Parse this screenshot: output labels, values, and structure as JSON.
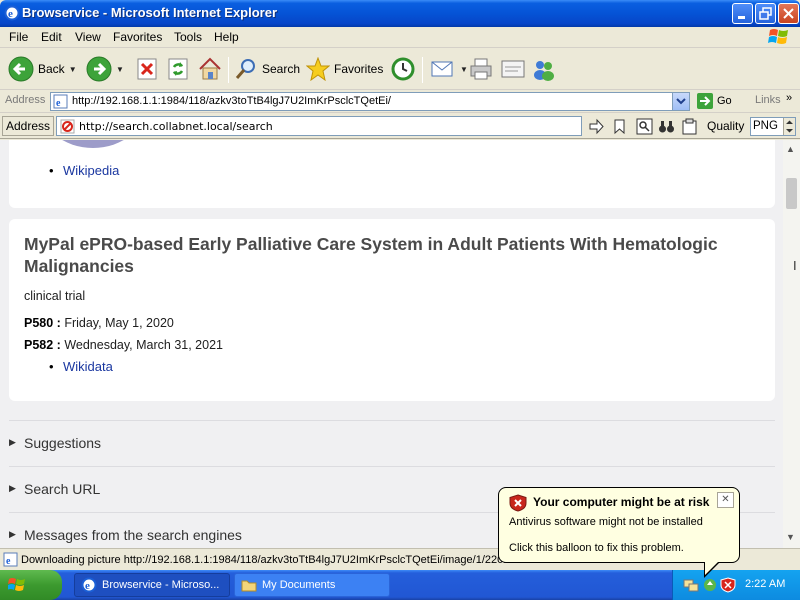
{
  "window": {
    "title": "Browservice - Microsoft Internet Explorer"
  },
  "menu": [
    "File",
    "Edit",
    "View",
    "Favorites",
    "Tools",
    "Help"
  ],
  "toolbar": {
    "back_label": "Back",
    "search_label": "Search",
    "favorites_label": "Favorites"
  },
  "address": {
    "label": "Address",
    "url": "http://192.168.1.1:1984/118/azkv3toTtB4lgJ7U2ImKrPsclcTQetEi/",
    "go_label": "Go",
    "links_label": "Links"
  },
  "inner_address": {
    "label": "Address",
    "url": "http://search.collabnet.local/search",
    "quality_label": "Quality",
    "quality_value": "PNG"
  },
  "content": {
    "card1_link": "Wikipedia",
    "result": {
      "title": "MyPal ePRO-based Early Palliative Care System in Adult Patients With Hematologic Malignancies",
      "type": "clinical trial",
      "props": [
        {
          "key": "P580 :",
          "value": " Friday, May 1, 2020"
        },
        {
          "key": "P582 :",
          "value": " Wednesday, March 31, 2021"
        }
      ],
      "link": "Wikidata"
    },
    "sections": [
      "Suggestions",
      "Search URL",
      "Messages from the search engines"
    ]
  },
  "status": {
    "text": "Downloading picture http://192.168.1.1:1984/118/azkv3toTtB4lgJ7U2ImKrPsclcTQetEi/image/1/220..."
  },
  "taskbar": {
    "start_label": "start",
    "tasks": [
      "Browservice - Microso...",
      "My Documents"
    ],
    "clock": "2:22 AM"
  },
  "balloon": {
    "title": "Your computer might be at risk",
    "line1": "Antivirus software might not be installed",
    "line2": "Click this balloon to fix this problem."
  },
  "colors": {
    "xp_blue": "#0553d6",
    "link": "#1a37a0",
    "balloon": "#ffffe1"
  }
}
